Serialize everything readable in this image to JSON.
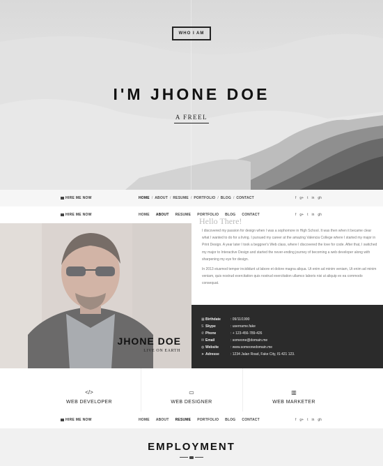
{
  "hero": {
    "button_label": "WHO I AM",
    "title": "I'M JHONE DOE",
    "subtitle": "A FREEL"
  },
  "nav": {
    "hire_label": "HIRE ME NOW",
    "items": [
      "HOME",
      "ABOUT",
      "RESUME",
      "PORTFOLIO",
      "BLOG",
      "CONTACT"
    ],
    "social": [
      "f",
      "g+",
      "t",
      "in",
      "gh"
    ]
  },
  "about": {
    "name": "JHONE DOE",
    "location": "LIVE ON EARTH",
    "hello": "Hello There!",
    "bio1": "I discovered my passion for design when I was a sophomore in High School. It was then when it became clear what I wanted to do for a living. I pursued my career at the amazing Valencia College where I started my major in Print Design. A year later I took a beggner's Web class, where I discovered the love for code. After that, I switched my major to Interactive Design and started the never-ending journey of becoming a web developer along with sharpening my eye for design.",
    "bio2": "In 2013 eiusmod tempor incididunt ut labore et dolore magna aliqua. Ut enim ad minim veniam, Ut enim ad minim veniam, quis nostrud exercitation quis nostrud exercitation ullamco laboris nisi ut aliquip ex ea commodo consequat."
  },
  "info": [
    {
      "icon": "calendar-icon",
      "glyph": "▦",
      "label": "Birthdate",
      "value": ": 09/11/1990"
    },
    {
      "icon": "skype-icon",
      "glyph": "S",
      "label": "Skype",
      "value": ": username.fake"
    },
    {
      "icon": "phone-icon",
      "glyph": "✆",
      "label": "Phone",
      "value": ": + 123-456-789-426"
    },
    {
      "icon": "mail-icon",
      "glyph": "✉",
      "label": "Email",
      "value": ": someone@domain.me"
    },
    {
      "icon": "globe-icon",
      "glyph": "◍",
      "label": "Website",
      "value": ": www.someonedomain.me"
    },
    {
      "icon": "location-icon",
      "glyph": "➤",
      "label": "Adresse",
      "value": ": 1234 Jalan Road, Fake City, IS 421 123."
    }
  ],
  "services": [
    {
      "icon": "code-icon",
      "glyph": "</>",
      "label": "WEB DEVELOPER"
    },
    {
      "icon": "laptop-icon",
      "glyph": "▭",
      "label": "WEB DESIGNER"
    },
    {
      "icon": "chart-icon",
      "glyph": "▥",
      "label": "WEB MARKETER"
    }
  ],
  "employment": {
    "title": "EMPLOYMENT"
  },
  "colors": {
    "info_bg": "#2b2b2b",
    "section_bg": "#f1f1f1"
  }
}
